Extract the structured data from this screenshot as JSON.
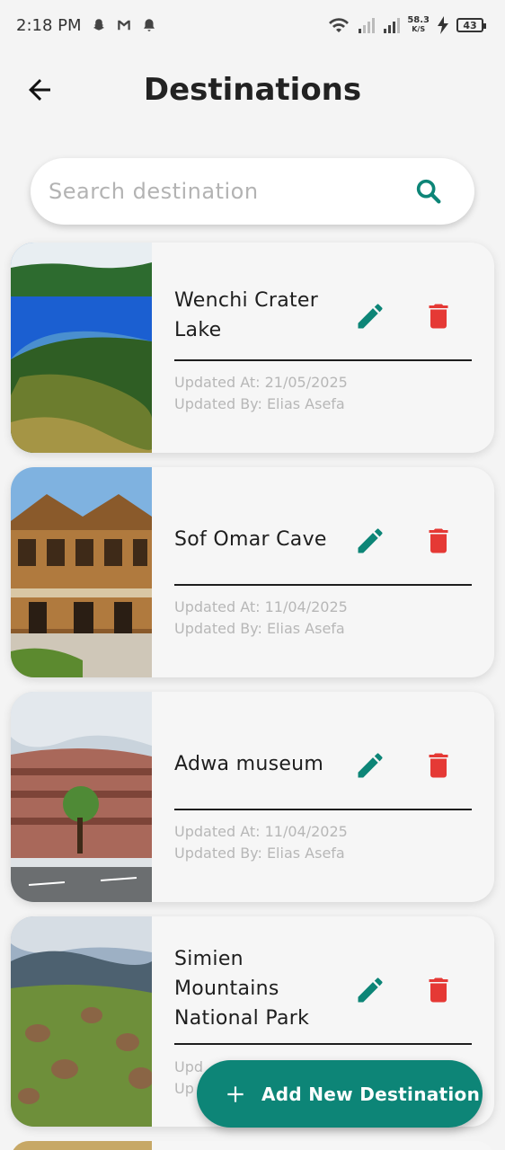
{
  "status_bar": {
    "time": "2:18 PM",
    "speed_value": "58.3",
    "speed_unit": "K/S",
    "battery": "43"
  },
  "header": {
    "title": "Destinations",
    "back_icon": "arrow-left-icon"
  },
  "search": {
    "placeholder": "Search destination",
    "icon": "search-icon"
  },
  "colors": {
    "accent": "#0d8577",
    "delete": "#e53935",
    "background": "#f4f4f4"
  },
  "destinations": [
    {
      "name_lines": [
        "Wenchi Crater",
        "Lake"
      ],
      "updated_at": "Updated At: 21/05/2025",
      "updated_by": "Updated By: Elias Asefa"
    },
    {
      "name_lines": [
        "Sof Omar Cave"
      ],
      "updated_at": "Updated At: 11/04/2025",
      "updated_by": "Updated By: Elias Asefa"
    },
    {
      "name_lines": [
        "Adwa museum"
      ],
      "updated_at": "Updated At: 11/04/2025",
      "updated_by": "Updated By: Elias Asefa"
    },
    {
      "name_lines": [
        "Simien",
        "Mountains",
        "National Park"
      ],
      "updated_at": "Upd",
      "updated_by": "Up"
    }
  ],
  "fab": {
    "label": "Add New Destination",
    "icon": "plus-icon"
  }
}
